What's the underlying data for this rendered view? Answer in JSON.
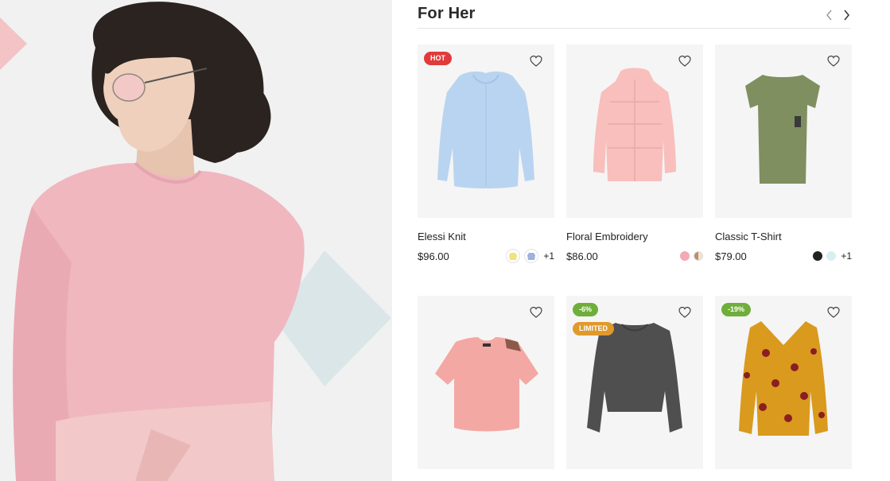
{
  "section": {
    "title": "For Her"
  },
  "nav": {
    "prev_icon": "chevron-left-icon",
    "next_icon": "chevron-right-icon"
  },
  "colors": {
    "hot": "#e13a3a",
    "sale": "#6fae3a",
    "limited": "#e09a2c",
    "card_bg": "#f5f5f5"
  },
  "products": [
    {
      "name": "Elessi Knit",
      "price": "$96.00",
      "badge": "HOT",
      "more": "+1"
    },
    {
      "name": "Floral Embroidery",
      "price": "$86.00"
    },
    {
      "name": "Classic T-Shirt",
      "price": "$79.00",
      "more": "+1"
    },
    {
      "name": "",
      "price": ""
    },
    {
      "name": "",
      "price": "",
      "badge": "-6%",
      "badge2": "LIMITED"
    },
    {
      "name": "",
      "price": "",
      "badge": "-19%"
    }
  ]
}
